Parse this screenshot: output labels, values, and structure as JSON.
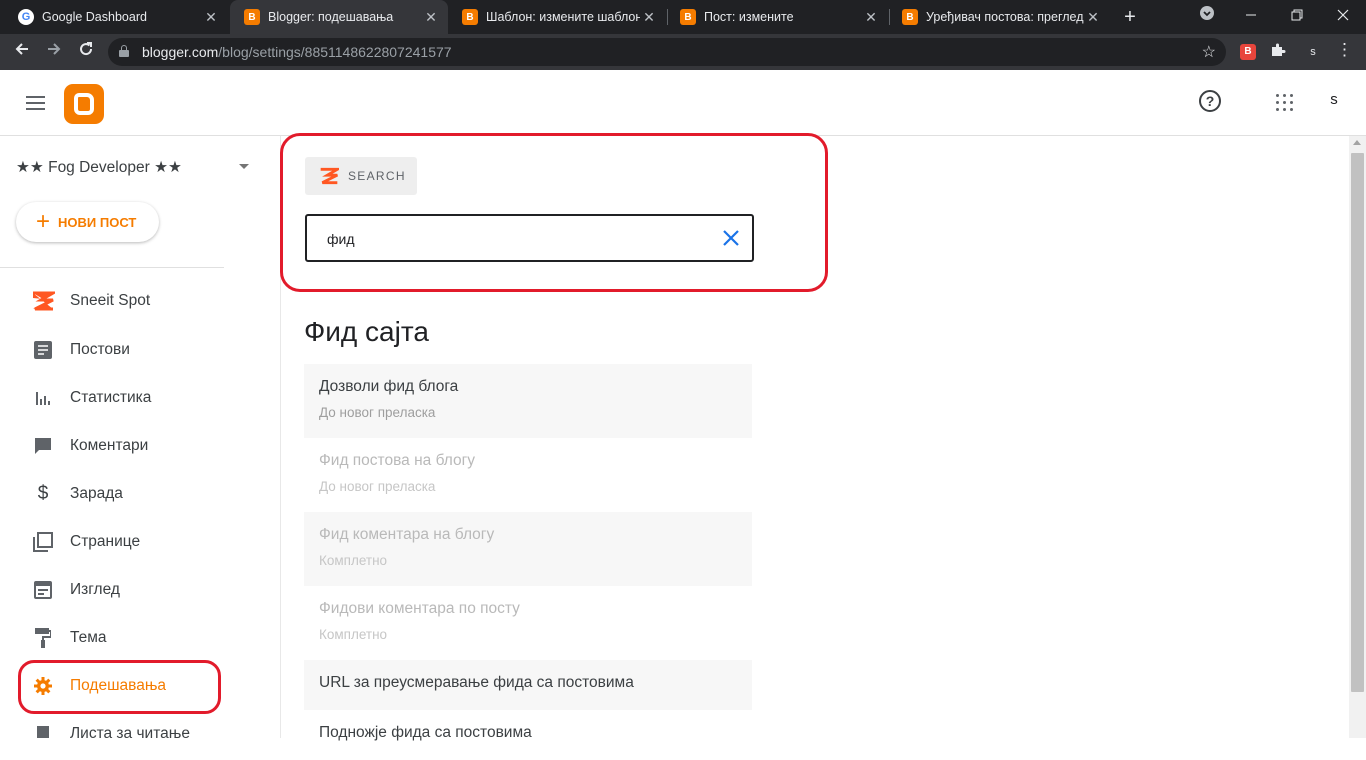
{
  "browser": {
    "tabs": [
      {
        "title": "Google Dashboard",
        "close": "✕",
        "favicon": "google-icon"
      },
      {
        "title": "Blogger: подешавања",
        "close": "✕",
        "favicon": "blogger-icon"
      },
      {
        "title": "Шаблон: измените шаблон",
        "close": "✕",
        "favicon": "blogger-icon"
      },
      {
        "title": "Пост: измените",
        "close": "✕",
        "favicon": "blogger-icon"
      },
      {
        "title": "Уређивач постова: преглед",
        "close": "✕",
        "favicon": "blogger-icon"
      }
    ],
    "new_tab": "+",
    "url_host": "blogger.com",
    "url_path": "/blog/settings/8851148622807241577",
    "profile_initial": "s"
  },
  "header": {
    "avatar_initial": "s"
  },
  "sidebar": {
    "blog_name": "★★ Fog Developer ★★",
    "new_post_label": "НОВИ ПОСТ",
    "new_post_plus": "+",
    "items": [
      {
        "label": "Sneeit Spot",
        "icon": "sneeit-logo-icon"
      },
      {
        "label": "Постови",
        "icon": "posts-icon"
      },
      {
        "label": "Статистика",
        "icon": "stats-icon"
      },
      {
        "label": "Коментари",
        "icon": "comment-icon"
      },
      {
        "label": "Зарада",
        "icon": "dollar-icon"
      },
      {
        "label": "Странице",
        "icon": "pages-icon"
      },
      {
        "label": "Изглед",
        "icon": "layout-icon"
      },
      {
        "label": "Тема",
        "icon": "paint-roller-icon"
      },
      {
        "label": "Подешавања",
        "icon": "gear-icon",
        "active": true
      },
      {
        "label": "Листа за читање",
        "icon": "bookmark-icon"
      }
    ]
  },
  "main": {
    "search_chip_label": "SEARCH",
    "search_value": "фид",
    "section_title": "Фид сајта",
    "settings": [
      {
        "title": "Дозволи фид блога",
        "subtitle": "До новог преласка"
      },
      {
        "title": "Фид постова на блогу",
        "subtitle": "До новог преласка"
      },
      {
        "title": "Фид коментара на блогу",
        "subtitle": "Комплетно"
      },
      {
        "title": "Фидови коментара по посту",
        "subtitle": "Комплетно"
      },
      {
        "title": "URL за преусмеравање фида са постовима",
        "subtitle": ""
      },
      {
        "title": "Подножје фида са постовима",
        "subtitle": ""
      }
    ]
  },
  "colors": {
    "accent": "#f57c00",
    "annotation": "#e21b2b",
    "link_blue": "#1a73e8"
  }
}
